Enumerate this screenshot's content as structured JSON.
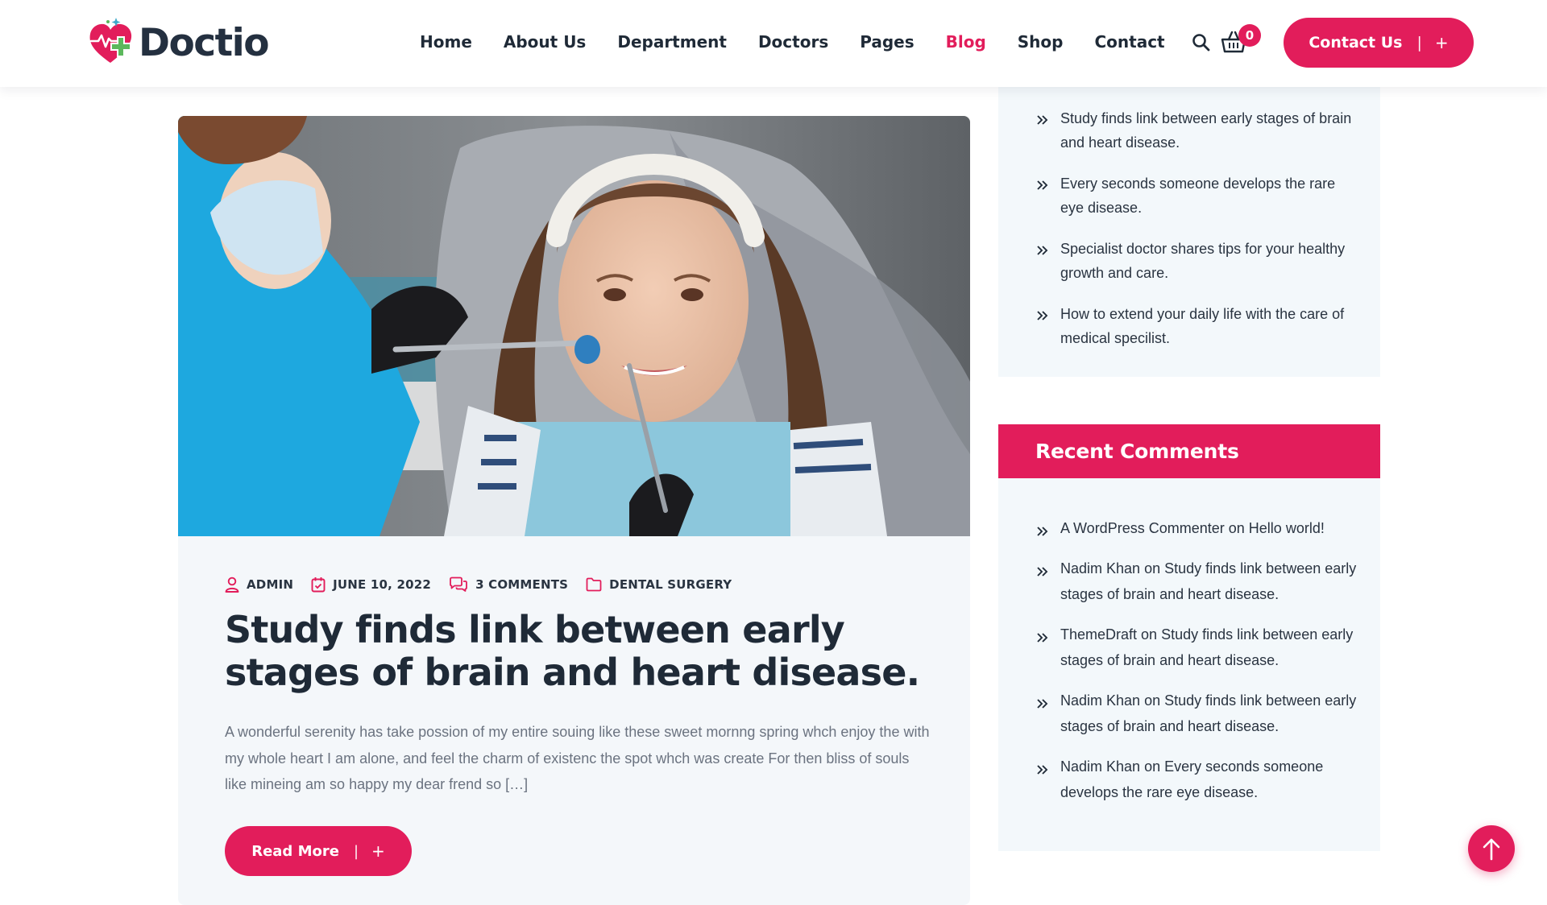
{
  "header": {
    "logo_text": "Doctio",
    "nav": [
      {
        "label": "Home",
        "active": false
      },
      {
        "label": "About Us",
        "active": false
      },
      {
        "label": "Department",
        "active": false
      },
      {
        "label": "Doctors",
        "active": false
      },
      {
        "label": "Pages",
        "active": false
      },
      {
        "label": "Blog",
        "active": true
      },
      {
        "label": "Shop",
        "active": false
      },
      {
        "label": "Contact",
        "active": false
      }
    ],
    "search_icon": "search-icon",
    "cart_icon": "cart-icon",
    "cart_count": "0",
    "contact_button": {
      "label": "Contact Us",
      "separator": "|",
      "plus": "+"
    }
  },
  "post": {
    "image_alt": "Girl smiling in a dental chair while a dentist in a mask examines her teeth",
    "meta": {
      "author": "ADMIN",
      "date": "JUNE 10, 2022",
      "comments": "3 COMMENTS",
      "category": "DENTAL SURGERY"
    },
    "title": "Study finds link between early stages of brain and heart disease.",
    "excerpt": "A wonderful serenity has take possion of my entire souing like these sweet mornng spring whch enjoy the with my whole heart I am alone, and feel the charm of existenc the spot whch was create For then bliss of souls like mineing am so happy my dear frend so […]",
    "read_more": {
      "label": "Read More",
      "separator": "|",
      "plus": "+"
    }
  },
  "sidebar": {
    "recent_posts": [
      "Study finds link between early stages of brain and heart disease.",
      "Every seconds someone develops the rare eye disease.",
      "Specialist doctor shares tips for your healthy growth and care.",
      "How to extend your daily life with the care of medical specilist."
    ],
    "recent_comments_title": "Recent Comments",
    "recent_comments": [
      {
        "author": "A WordPress Commenter",
        "on": "on",
        "post": "Hello world!"
      },
      {
        "author": "Nadim Khan",
        "on": "on",
        "post": "Study finds link between early stages of brain and heart disease."
      },
      {
        "author": "ThemeDraft",
        "on": "on",
        "post": "Study finds link between early stages of brain and heart disease."
      },
      {
        "author": "Nadim Khan",
        "on": "on",
        "post": "Study finds link between early stages of brain and heart disease."
      },
      {
        "author": "Nadim Khan",
        "on": "on",
        "post": "Every seconds someone develops the rare eye disease."
      }
    ]
  },
  "back_to_top_icon": "arrow-up-icon",
  "colors": {
    "accent": "#e21d5b",
    "heading": "#1f2a37",
    "body_text": "#6b7380",
    "card_bg": "#f4f7fa",
    "sidebar_bg": "#f3f8fb"
  }
}
